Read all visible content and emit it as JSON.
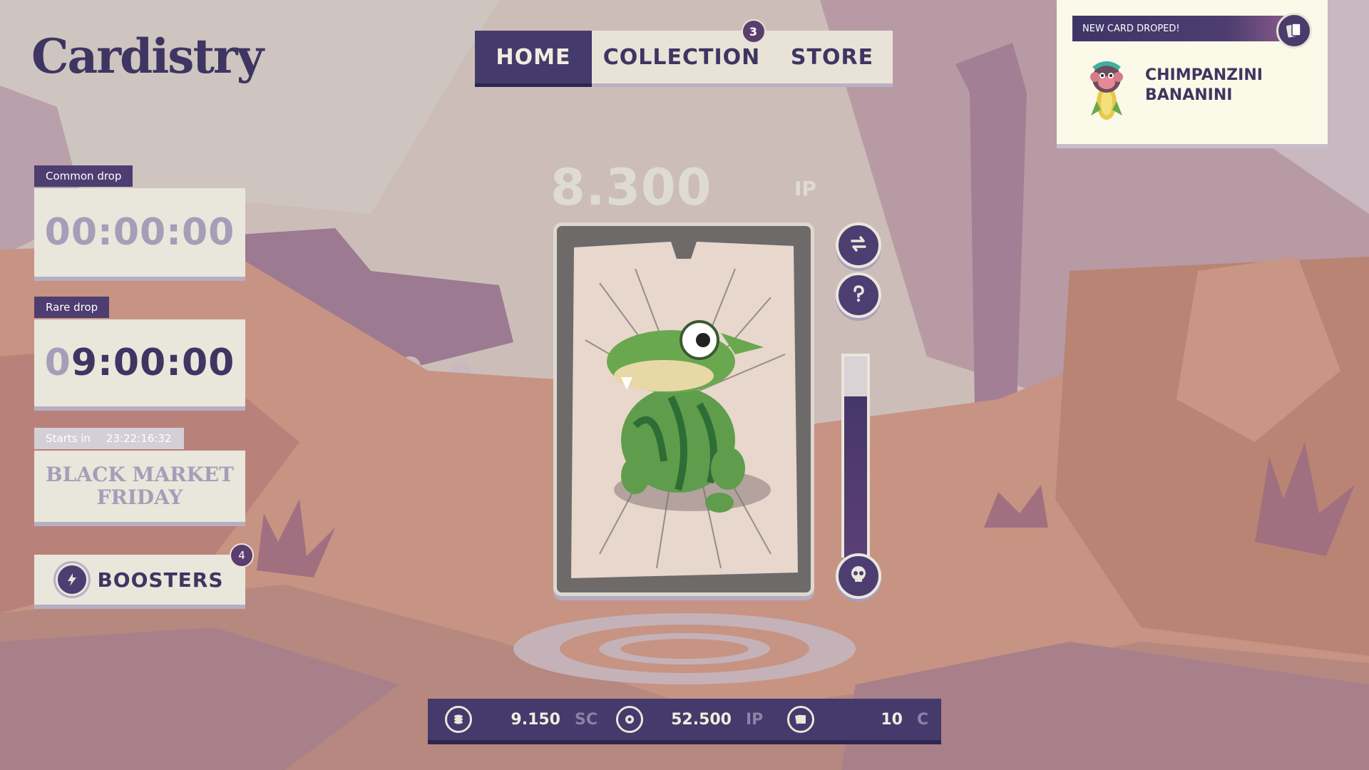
{
  "app": {
    "logo": "Cardistry"
  },
  "nav": {
    "tabs": [
      {
        "label": "HOME",
        "active": true
      },
      {
        "label": "COLLECTION",
        "badge": "3"
      },
      {
        "label": "STORE"
      }
    ]
  },
  "notification": {
    "title": "NEW CARD DROPED!",
    "card_name_line1": "CHIMPANZINI",
    "card_name_line2": "BANANINI"
  },
  "drops": {
    "common": {
      "label": "Common drop",
      "time": "00:00:00"
    },
    "rare": {
      "label": "Rare drop",
      "time_faded": "0",
      "time": "9:00:00"
    },
    "event": {
      "starts_label": "Starts in",
      "countdown": "23:22:16:32",
      "title_line1": "BLACK MARKET",
      "title_line2": "FRIDAY"
    }
  },
  "boosters": {
    "label": "BOOSTERS",
    "badge": "4"
  },
  "score": {
    "value": "8.300",
    "unit": "IP"
  },
  "currencies": [
    {
      "icon": "coins-icon",
      "value": "9.150",
      "unit": "SC"
    },
    {
      "icon": "gem-icon",
      "value": "52.500",
      "unit": "IP"
    },
    {
      "icon": "cards-icon",
      "value": "10",
      "unit": "C"
    }
  ],
  "meter": {
    "level": 0.8
  },
  "colors": {
    "primary": "#443a6b",
    "panel": "#e9e6dc",
    "accent": "#8f3a6b"
  }
}
